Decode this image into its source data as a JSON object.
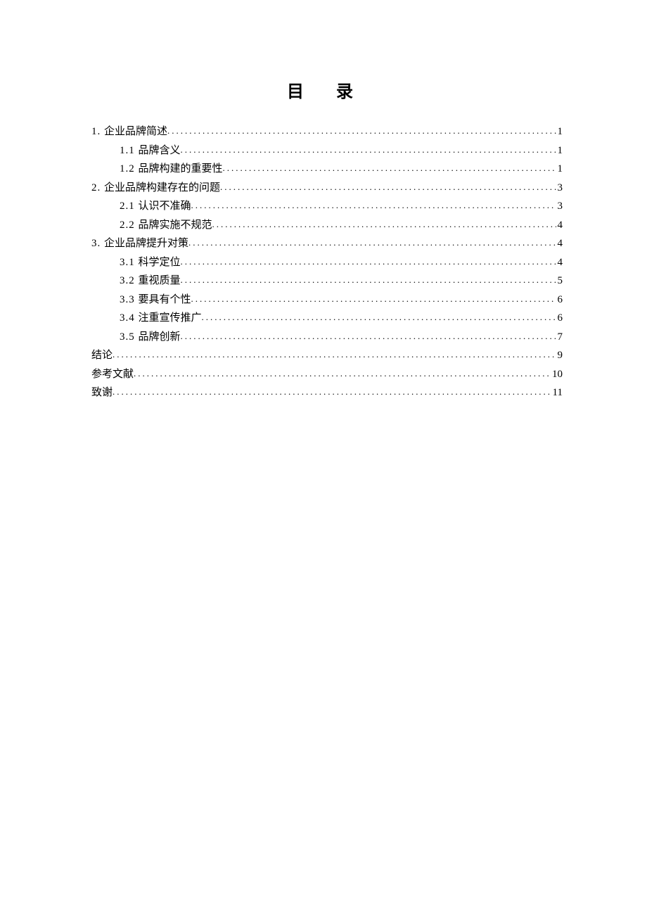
{
  "title": "目 录",
  "toc": [
    {
      "level": 1,
      "num": "1. ",
      "label": "企业品牌简述",
      "page": "1"
    },
    {
      "level": 2,
      "num": "1.1 ",
      "label": "品牌含义",
      "page": "1"
    },
    {
      "level": 2,
      "num": "1.2 ",
      "label": "品牌构建的重要性",
      "page": "1"
    },
    {
      "level": 1,
      "num": "2. ",
      "label": "企业品牌构建存在的问题",
      "page": "3"
    },
    {
      "level": 2,
      "num": "2.1 ",
      "label": "认识不准确",
      "page": "3"
    },
    {
      "level": 2,
      "num": "2.2 ",
      "label": "品牌实施不规范",
      "page": "4"
    },
    {
      "level": 1,
      "num": "3. ",
      "label": "企业品牌提升对策",
      "page": "4"
    },
    {
      "level": 2,
      "num": "3.1 ",
      "label": "科学定位",
      "page": "4"
    },
    {
      "level": 2,
      "num": "3.2 ",
      "label": "重视质量",
      "page": "5"
    },
    {
      "level": 2,
      "num": "3.3 ",
      "label": "要具有个性",
      "page": "6"
    },
    {
      "level": 2,
      "num": "3.4 ",
      "label": "注重宣传推广",
      "page": "6"
    },
    {
      "level": 2,
      "num": "3.5 ",
      "label": "品牌创新",
      "page": "7"
    },
    {
      "level": 1,
      "num": "",
      "label": "结论",
      "page": "9"
    },
    {
      "level": 1,
      "num": "",
      "label": "参考文献",
      "page": "10"
    },
    {
      "level": 1,
      "num": "",
      "label": "致谢",
      "page": "11"
    }
  ]
}
